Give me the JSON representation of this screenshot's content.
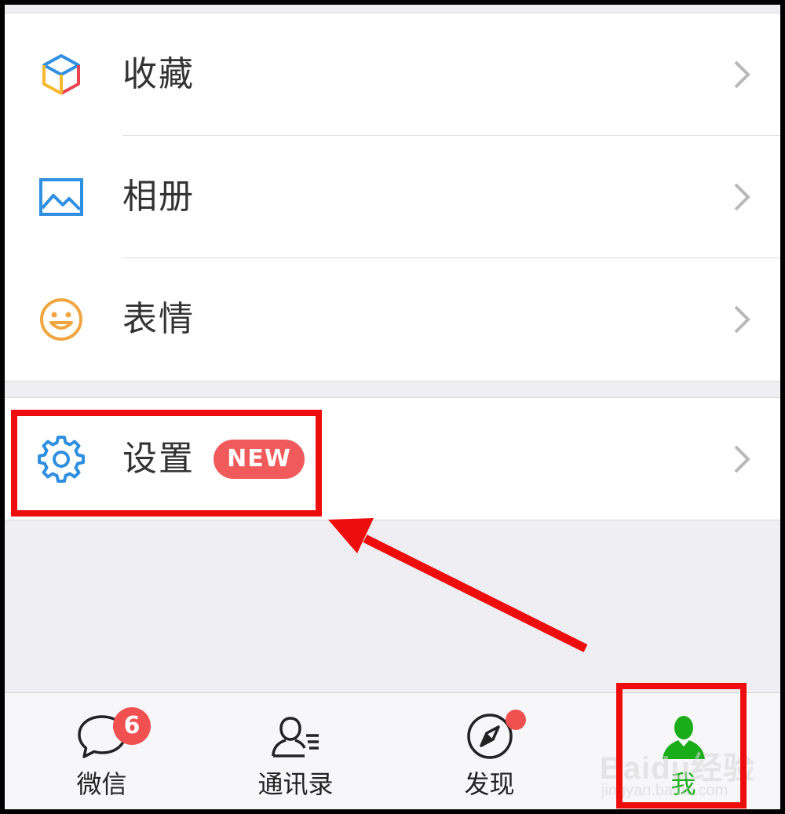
{
  "menu": {
    "items": [
      {
        "label": "收藏",
        "icon": "favorites-cube-icon"
      },
      {
        "label": "相册",
        "icon": "album-picture-icon"
      },
      {
        "label": "表情",
        "icon": "sticker-smiley-icon"
      }
    ],
    "settings": {
      "label": "设置",
      "icon": "settings-gear-icon",
      "badge": "NEW"
    }
  },
  "tabbar": {
    "tabs": [
      {
        "label": "微信",
        "icon": "chat-bubble-icon",
        "badge": "6"
      },
      {
        "label": "通讯录",
        "icon": "contacts-icon"
      },
      {
        "label": "发现",
        "icon": "compass-icon",
        "dot": true
      },
      {
        "label": "我",
        "icon": "person-icon",
        "active": true
      }
    ]
  },
  "watermark": {
    "brand": "Baidu经验",
    "url": "jingyan.baidu.com"
  },
  "colors": {
    "accent_green": "#1aad19",
    "badge_red": "#f15050",
    "highlight_red": "#ee0d0d",
    "icon_blue": "#2f8fe0"
  }
}
